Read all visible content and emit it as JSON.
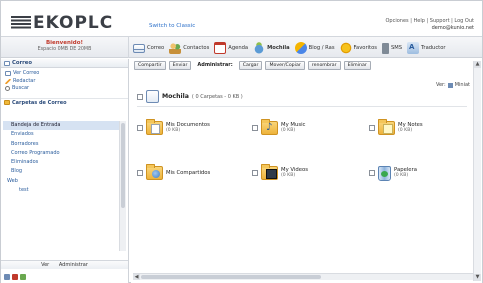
{
  "header": {
    "logo": "EKOPLC",
    "switch_link": "Switch to Classic",
    "util_links": "Opciones | Help | Support | Log Out",
    "user_email": "demo@kunio.net"
  },
  "user": {
    "name": "Bienvenido!",
    "quota": "Espacio 0MB DE 20MB"
  },
  "toolbar": [
    {
      "label": "Correo",
      "icon": "mail-icon"
    },
    {
      "label": "Contactos",
      "icon": "contacts-icon"
    },
    {
      "label": "Agenda",
      "icon": "agenda-icon"
    },
    {
      "label": "Mochila",
      "icon": "backpack-icon"
    },
    {
      "label": "Blog / Ras",
      "icon": "blog-icon"
    },
    {
      "label": "Favoritos",
      "icon": "favorites-icon"
    },
    {
      "label": "SMS",
      "icon": "sms-icon"
    },
    {
      "label": "Traductor",
      "icon": "translator-icon"
    }
  ],
  "sidebar": {
    "section_title": "Correo",
    "actions": [
      "Ver Correo",
      "Redactar",
      "Buscar"
    ],
    "folders_title": "Carpetas de Correo",
    "folders": [
      {
        "label": "Bandeja de Entrada",
        "active": true,
        "level": 1
      },
      {
        "label": "Enviados",
        "active": false,
        "level": 1
      },
      {
        "label": "Borradores",
        "active": false,
        "level": 1
      },
      {
        "label": "Correo Programado",
        "active": false,
        "level": 1
      },
      {
        "label": "Eliminados",
        "active": false,
        "level": 1
      },
      {
        "label": "Blog",
        "active": false,
        "level": 1
      },
      {
        "label": "Web",
        "active": false,
        "level": 0
      },
      {
        "label": "test",
        "active": false,
        "level": 2
      }
    ],
    "footer_links": [
      "Ver",
      "Administrar"
    ]
  },
  "main": {
    "actions": [
      "Compartir",
      "Enviar",
      "Administrar:",
      "Cargar",
      "Mover/Copiar",
      "renombrar",
      "Eliminar"
    ],
    "view_label": "Ver:",
    "view_mode": "Miniat",
    "title": "Mochila",
    "title_meta": "( 0 Carpetas - 0 KB )",
    "folders": [
      {
        "name": "Mis Documentos",
        "size": "(0 KB)",
        "icon": "documents-folder-icon",
        "variant": "doc"
      },
      {
        "name": "My Music",
        "size": "(0 KB)",
        "icon": "music-folder-icon",
        "variant": "music"
      },
      {
        "name": "My Notes",
        "size": "(0 KB)",
        "icon": "notes-folder-icon",
        "variant": "notes"
      },
      {
        "name": "Mis Compartidos",
        "size": "",
        "icon": "shared-folder-icon",
        "variant": "shared"
      },
      {
        "name": "My Videos",
        "size": "(0 KB)",
        "icon": "videos-folder-icon",
        "variant": "video"
      },
      {
        "name": "Papelera",
        "size": "(0 KB)",
        "icon": "trash-icon",
        "variant": "trash"
      }
    ]
  },
  "colors": {
    "accent": "#2a6fc9",
    "user_name": "#c0392b",
    "active_folder_bg": "#d6e2f2"
  }
}
